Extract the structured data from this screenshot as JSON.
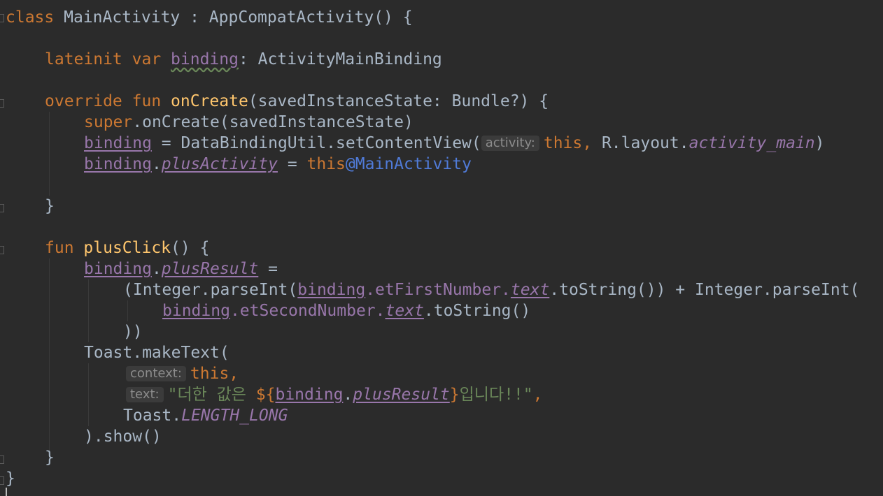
{
  "code": {
    "l1": {
      "kw_class": "class",
      "class_name": " MainActivity : AppCompatActivity() {"
    },
    "l2": {
      "kw_lateinit": "lateinit",
      "kw_var": "var",
      "binding": "binding",
      "type": ": ActivityMainBinding"
    },
    "l3": {
      "kw_override": "override",
      "kw_fun": "fun",
      "fn_name": "onCreate",
      "params": "(savedInstanceState: Bundle?) {"
    },
    "l4": {
      "kw_super": "super",
      "rest": ".onCreate(savedInstanceState)"
    },
    "l5": {
      "binding": "binding",
      "call": " = DataBindingUtil.setContentView(",
      "hint": "activity:",
      "kw_this": "this,",
      "r_layout": " R.layout.",
      "layout_name": "activity_main",
      "close": ")"
    },
    "l6": {
      "binding": "binding",
      "dot": ".",
      "prop": "plusActivity",
      "eq": " = ",
      "kw_this": "this",
      "label": "@MainActivity"
    },
    "l7": {
      "brace": "}"
    },
    "l8": {
      "kw_fun": "fun",
      "fn_name": "plusClick",
      "rest": "() {"
    },
    "l9": {
      "binding": "binding",
      "dot": ".",
      "prop": "plusResult",
      "eq": " ="
    },
    "l10": {
      "open": "(Integer.parseInt(",
      "binding": "binding",
      "field": ".etFirstNumber.",
      "text": "text",
      "rest": ".toString()) + Integer.parseInt("
    },
    "l11": {
      "binding": "binding",
      "field": ".etSecondNumber.",
      "text": "text",
      "rest": ".toString()"
    },
    "l12": {
      "close": "))"
    },
    "l13": {
      "call": "Toast.makeText("
    },
    "l14": {
      "hint": "context:",
      "kw_this": "this,",
      "empty": ""
    },
    "l15": {
      "hint": "text:",
      "str_open": "\"더한 값은 ",
      "tmpl_open": "${",
      "binding": "binding",
      "dot": ".",
      "prop": "plusResult",
      "tmpl_close": "}",
      "str_close": "입니다!!\"",
      "comma": ","
    },
    "l16": {
      "toast": "Toast.",
      "const": "LENGTH_LONG"
    },
    "l17": {
      "show": ").show()"
    },
    "l18": {
      "brace": "}"
    },
    "l19": {
      "brace": "}"
    }
  },
  "colors": {
    "background": "#2b2b2b",
    "default_text": "#a9b7c6",
    "keyword": "#cc7832",
    "function": "#ffc66d",
    "property": "#9876aa",
    "string": "#6a8759",
    "label": "#507bd8",
    "hint_bg": "#3b3b3b",
    "hint_text": "#8c8c8c"
  }
}
